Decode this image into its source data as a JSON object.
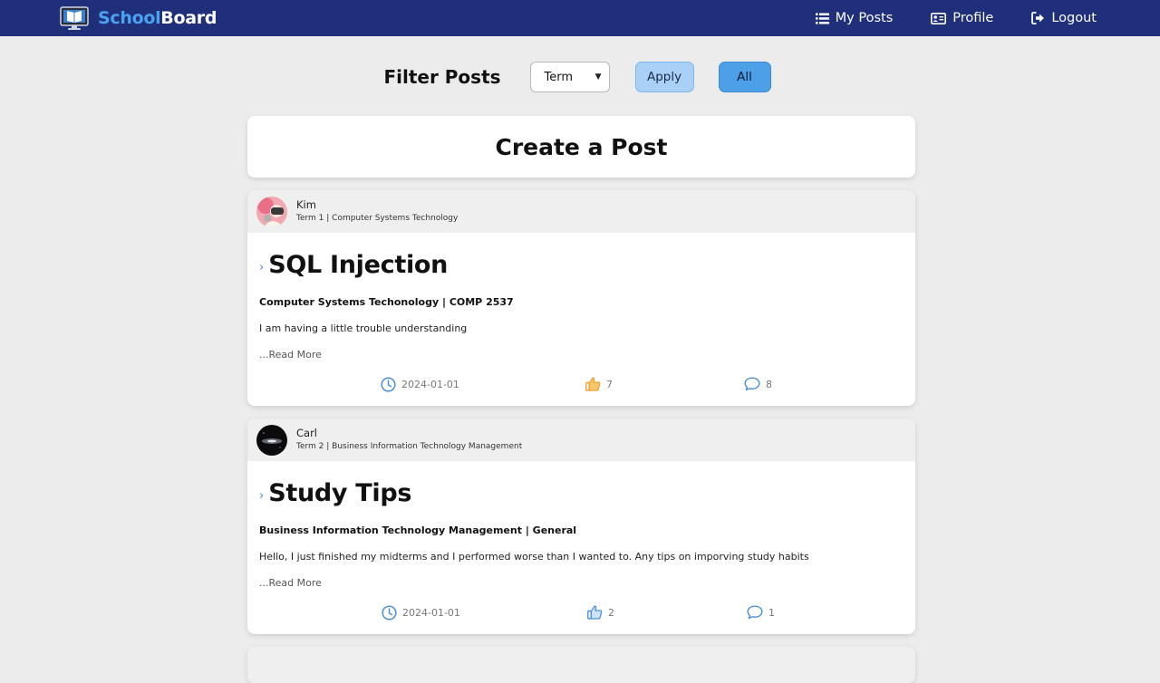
{
  "app": {
    "brand_part1": "School",
    "brand_part2": "Board"
  },
  "nav": {
    "items": [
      {
        "label": "My Posts",
        "icon": "list-icon"
      },
      {
        "label": "Profile",
        "icon": "id-card-icon"
      },
      {
        "label": "Logout",
        "icon": "logout-icon"
      }
    ]
  },
  "filter": {
    "title": "Filter Posts",
    "select_value": "Term",
    "apply_label": "Apply",
    "all_label": "All"
  },
  "create_post": {
    "label": "Create a Post"
  },
  "posts": [
    {
      "author": "Kim",
      "meta": "Term 1 | Computer Systems Technology",
      "title": "SQL Injection",
      "subtitle": "Computer Systems Techonology | COMP 2537",
      "excerpt": "I am having a little trouble understanding",
      "read_more": "...Read More",
      "date": "2024-01-01",
      "likes": "7",
      "comments": "8",
      "like_color": "#f0a030"
    },
    {
      "author": "Carl",
      "meta": "Term 2 | Business Information Technology Management",
      "title": "Study Tips",
      "subtitle": "Business Information Technology Management | General",
      "excerpt": "Hello, I just finished my midterms and I performed worse than I wanted to. Any tips on imporving study habits",
      "read_more": "...Read More",
      "date": "2024-01-01",
      "likes": "2",
      "comments": "1",
      "like_color": "#4a90d9"
    }
  ],
  "colors": {
    "navbar": "#1f2f7a",
    "brand_accent": "#4aa3f0",
    "page_bg": "#ececec"
  }
}
